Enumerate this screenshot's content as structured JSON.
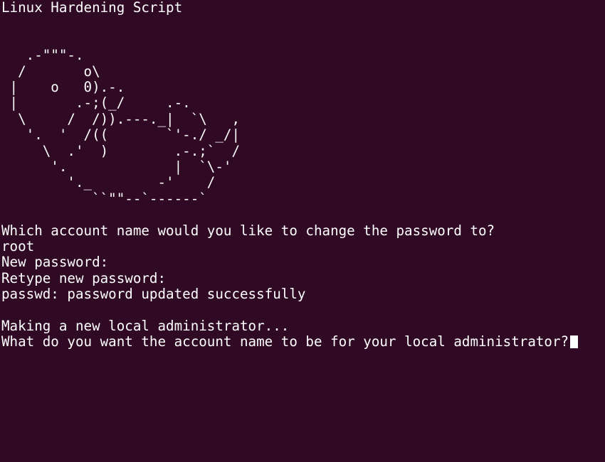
{
  "colors": {
    "background": "#300a24",
    "foreground": "#ffffff"
  },
  "terminal": {
    "title": "Linux Hardening Script",
    "ascii_art": [
      "",
      "",
      "   .-\"\"\"-.",
      "  /       o\\",
      " |    o   0).-.",
      " |       .-;(_/     .-.",
      "  \\     /  /)).---._|  `\\   ,",
      "   '.  '  /((       `'-./ _/|",
      "     \\  .'  )        .-.;`  /",
      "      '.             |  `\\-'",
      "        '._        -'    /",
      "           ``\"\"--`------`"
    ],
    "output": [
      "",
      "Which account name would you like to change the password to?",
      "root",
      "New password:",
      "Retype new password:",
      "passwd: password updated successfully",
      "",
      "Making a new local administrator...",
      "What do you want the account name to be for your local administrator?"
    ]
  }
}
